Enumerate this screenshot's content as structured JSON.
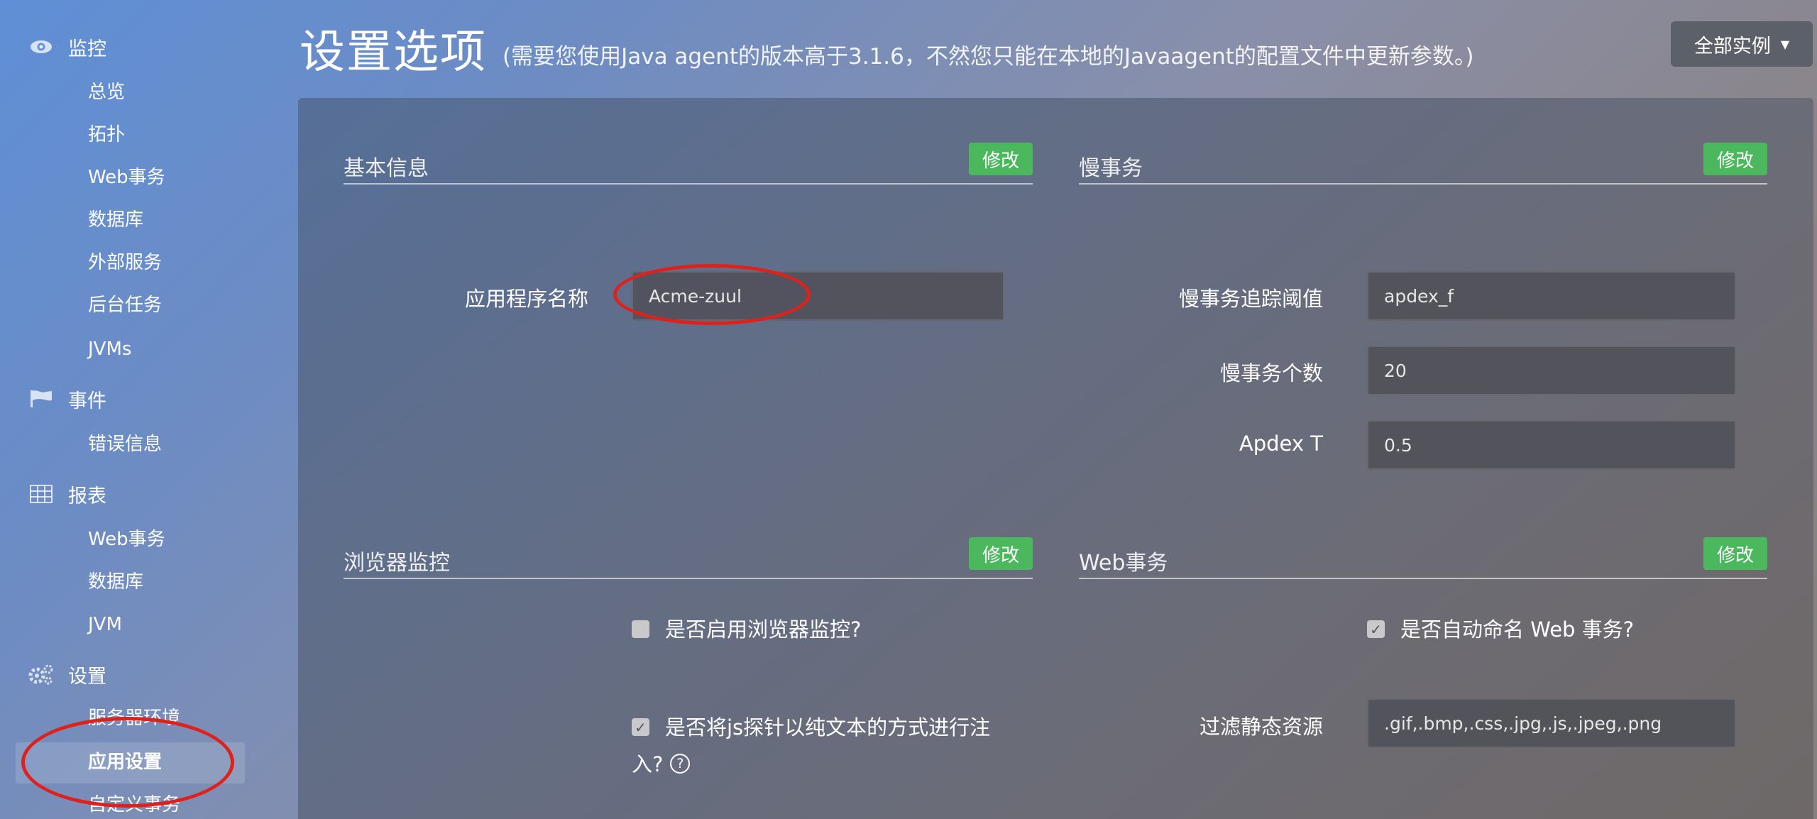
{
  "sidebar": {
    "sections": [
      {
        "title": "监控",
        "icon": "eye-icon",
        "items": [
          "总览",
          "拓扑",
          "Web事务",
          "数据库",
          "外部服务",
          "后台任务",
          "JVMs"
        ]
      },
      {
        "title": "事件",
        "icon": "flag-icon",
        "items": [
          "错误信息"
        ]
      },
      {
        "title": "报表",
        "icon": "table-icon",
        "items": [
          "Web事务",
          "数据库",
          "JVM"
        ]
      },
      {
        "title": "设置",
        "icon": "gears-icon",
        "items": [
          "服务器环境",
          "应用设置",
          "自定义事务"
        ]
      }
    ],
    "active_item": "应用设置"
  },
  "header": {
    "title": "设置选项",
    "subtitle": "(需要您使用Java agent的版本高于3.1.6，不然您只能在本地的Javaagent的配置文件中更新参数。)",
    "instance_button": "全部实例"
  },
  "edit_label": "修改",
  "basic_info": {
    "title": "基本信息",
    "app_name_label": "应用程序名称",
    "app_name_value": "Acme-zuul"
  },
  "slow_txn": {
    "title": "慢事务",
    "threshold_label": "慢事务追踪阈值",
    "threshold_value": "apdex_f",
    "count_label": "慢事务个数",
    "count_value": "20",
    "apdex_label": "Apdex T",
    "apdex_value": "0.5"
  },
  "browser_monitor": {
    "title": "浏览器监控",
    "enable_label": "是否启用浏览器监控?",
    "enable_checked": false,
    "inject_label_line1": "是否将js探针以纯文本的方式进行注",
    "inject_label_line2": "入?",
    "inject_checked": true
  },
  "web_txn": {
    "title": "Web事务",
    "auto_name_label": "是否自动命名 Web 事务?",
    "auto_name_checked": true,
    "filter_label": "过滤静态资源",
    "filter_value": ".gif,.bmp,.css,.jpg,.js,.jpeg,.png"
  },
  "colors": {
    "accent_green": "#4bb85d",
    "highlight_red": "#e0201a"
  }
}
